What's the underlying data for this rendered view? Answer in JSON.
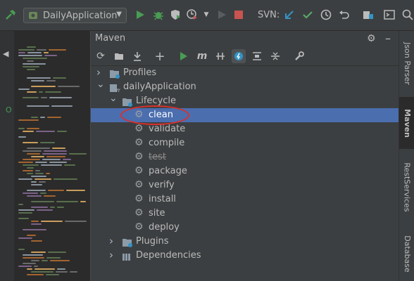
{
  "toolbar": {
    "run_config": "DailyApplication",
    "svn_label": "SVN:",
    "icons": [
      "hammer-icon",
      "run-icon",
      "debug-icon",
      "coverage-icon",
      "profile-icon",
      "stop-icon",
      "svn-update-icon",
      "svn-commit-icon",
      "history-icon",
      "revert-icon",
      "project-structure-icon",
      "terminal-icon"
    ],
    "colors": {
      "run": "#499c54",
      "stop": "#c75450",
      "update": "#3592c4",
      "commit": "#59a869"
    }
  },
  "maven": {
    "title": "Maven",
    "tree": [
      {
        "label": "Profiles",
        "level": 0,
        "expanded": false,
        "kind": "folder"
      },
      {
        "label": "dailyApplication",
        "level": 0,
        "expanded": true,
        "kind": "project"
      },
      {
        "label": "Lifecycle",
        "level": 1,
        "expanded": true,
        "kind": "folder"
      },
      {
        "label": "clean",
        "level": 2,
        "kind": "goal",
        "selected": true
      },
      {
        "label": "validate",
        "level": 2,
        "kind": "goal"
      },
      {
        "label": "compile",
        "level": 2,
        "kind": "goal"
      },
      {
        "label": "test",
        "level": 2,
        "kind": "goal",
        "skipped": true
      },
      {
        "label": "package",
        "level": 2,
        "kind": "goal"
      },
      {
        "label": "verify",
        "level": 2,
        "kind": "goal"
      },
      {
        "label": "install",
        "level": 2,
        "kind": "goal"
      },
      {
        "label": "site",
        "level": 2,
        "kind": "goal"
      },
      {
        "label": "deploy",
        "level": 2,
        "kind": "goal"
      },
      {
        "label": "Plugins",
        "level": 1,
        "expanded": false,
        "kind": "folder"
      },
      {
        "label": "Dependencies",
        "level": 1,
        "expanded": false,
        "kind": "deps"
      }
    ],
    "selection_color": "#4b6eaf"
  },
  "right_tabs": {
    "json_parser": "Json Parser",
    "maven": "Maven",
    "rest_services": "RestServices",
    "database": "Database"
  }
}
